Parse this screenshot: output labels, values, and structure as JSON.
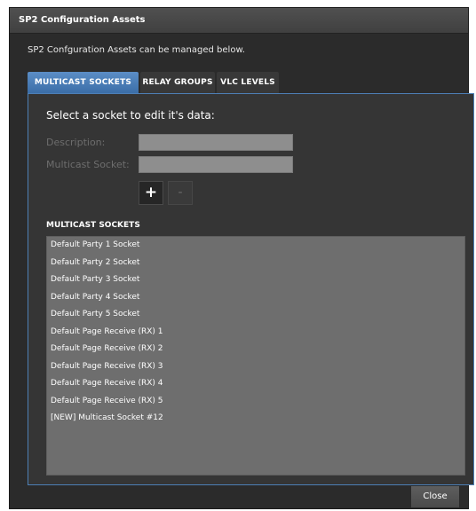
{
  "window": {
    "title": "SP2 Configuration Assets"
  },
  "intro_text": "SP2 Confguration Assets can be managed below.",
  "tabs": [
    {
      "label": "MULTICAST SOCKETS",
      "active": true
    },
    {
      "label": "RELAY GROUPS",
      "active": false
    },
    {
      "label": "VLC LEVELS",
      "active": false
    }
  ],
  "editor": {
    "heading": "Select a socket to edit it's data:",
    "description_label": "Description:",
    "description_value": "",
    "socket_label": "Multicast Socket:",
    "socket_value": "",
    "add_label": "+",
    "remove_label": "-"
  },
  "sockets": {
    "header": "MULTICAST SOCKETS",
    "items": [
      "Default Party 1 Socket",
      "Default Party 2 Socket",
      "Default Party 3 Socket",
      "Default Party 4 Socket",
      "Default Party 5 Socket",
      "Default Page Receive (RX) 1",
      "Default Page Receive (RX) 2",
      "Default Page Receive (RX) 3",
      "Default Page Receive (RX) 4",
      "Default Page Receive (RX) 5",
      "[NEW] Multicast Socket #12"
    ]
  },
  "footer": {
    "close_label": "Close"
  },
  "colors": {
    "accent": "#4a7fbd",
    "background": "#2b2b2b",
    "list_background": "#6e6e6e"
  }
}
